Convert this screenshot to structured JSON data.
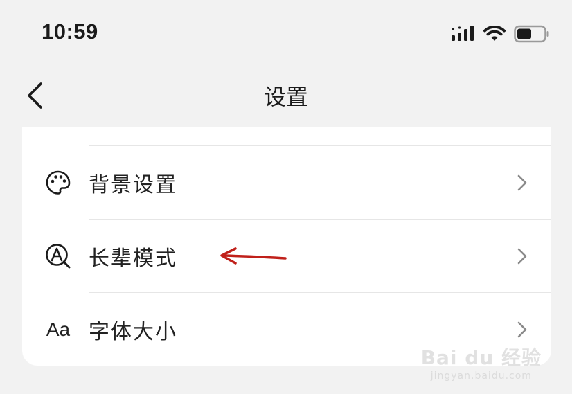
{
  "status_bar": {
    "time": "10:59",
    "icons": [
      "cellular-signal-icon",
      "wifi-icon",
      "battery-icon"
    ]
  },
  "nav": {
    "back_icon": "back-chevron-icon",
    "title": "设置"
  },
  "settings_list": {
    "items": [
      {
        "icon": "palette-icon",
        "label": "背景设置",
        "chevron": "chevron-right-icon"
      },
      {
        "icon": "elder-mode-icon",
        "label": "长辈模式",
        "chevron": "chevron-right-icon"
      },
      {
        "icon": "font-size-icon",
        "icon_text": "Aa",
        "label": "字体大小",
        "chevron": "chevron-right-icon"
      }
    ]
  },
  "annotation": {
    "icon": "red-arrow-icon",
    "color": "#c0201a"
  },
  "watermark": {
    "main": "Bai du 经验",
    "sub": "jingyan.baidu.com"
  },
  "colors": {
    "background": "#f2f2f2",
    "card": "#ffffff",
    "text": "#1a1a1a",
    "chevron": "#8a8a8a",
    "annotation_arrow": "#c0201a"
  }
}
